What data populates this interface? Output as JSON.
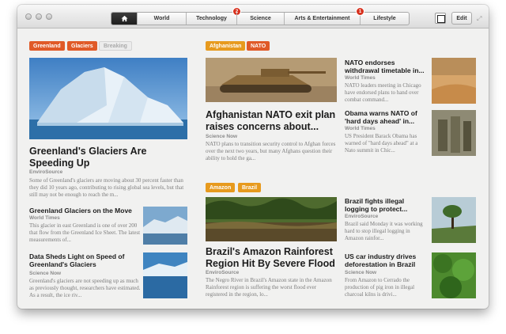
{
  "nav": {
    "tabs": [
      {
        "label": "",
        "icon": "home-icon"
      },
      {
        "label": "World"
      },
      {
        "label": "Technology",
        "badge": "2"
      },
      {
        "label": "Science"
      },
      {
        "label": "Arts & Entertainment"
      },
      {
        "label": "Lifestyle",
        "badge": "1"
      }
    ],
    "edit_label": "Edit"
  },
  "left": {
    "tags": [
      "Greenland",
      "Glaciers",
      "Breaking"
    ],
    "lead": {
      "title": "Greenland's Glaciers Are Speeding Up",
      "source": "EnviroSource",
      "body": "Some of Greenland's glaciers are moving about 30 percent faster than they did 10 years ago, contributing to rising global sea levels, but that still may not be enough to reach the m..."
    },
    "items": [
      {
        "title": "Greenland Glaciers on the Move",
        "source": "World Times",
        "body": "This glacier in east Greenland is one of over 200 that flow from the Greenland Ice Sheet. The latest measurements of..."
      },
      {
        "title": "Data Sheds Light on Speed of Greenland's Glaciers",
        "source": "Science Now",
        "body": "Greenland's glaciers are not speeding up as much as previously thought, researchers have estimated. As a result, the ice riv..."
      }
    ]
  },
  "mid": {
    "story1": {
      "tags": [
        "Afghanistan",
        "NATO"
      ],
      "title": "Afghanistan NATO exit plan raises concerns about...",
      "source": "Science Now",
      "body": "NATO plans to transition security control to Afghan forces over the next two years, but many Afghans question their ability to hold the ga..."
    },
    "story2": {
      "tags": [
        "Amazon",
        "Brazil"
      ],
      "title": "Brazil's Amazon Rainforest Region Hit By Severe Flood",
      "source": "EnviroSource",
      "body": "The Negro River in Brazil's Amazon state in the Amazon Rainforest region is suffering the worst flood ever registered in the region, lo..."
    }
  },
  "right": [
    {
      "title": "NATO endorses withdrawal timetable in...",
      "source": "World Times",
      "body": "NATO leaders meeting in Chicago have endorsed plans to hand over combat command..."
    },
    {
      "title": "Obama warns NATO of 'hard days ahead' in...",
      "source": "World Times",
      "body": "US President Barack Obama has warned of \"hard days ahead\" at a Nato summit in Chic..."
    },
    {
      "title": "Brazil fights illegal logging to protect...",
      "source": "EnviroSource",
      "body": "Brazil said Monday it was working hard to stop illegal logging in Amazon rainfor..."
    },
    {
      "title": "US car industry drives deforestation in Brazil",
      "source": "Science Now",
      "body": "From Amazon to Cerrado the production of pig iron in illegal charcoal kilns is drivi..."
    }
  ],
  "colors": {
    "tag_red": "#e05a28",
    "tag_amber": "#e79a1e",
    "badge": "#d7321f"
  }
}
